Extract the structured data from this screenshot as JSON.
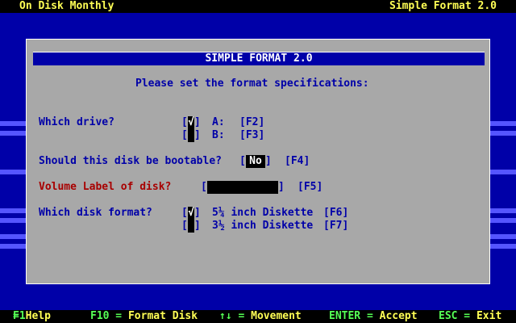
{
  "header": {
    "left": "On Disk Monthly",
    "right": "Simple Format 2.0"
  },
  "dialog": {
    "title": "SIMPLE FORMAT 2.0",
    "prompt": "Please set the format specifications:",
    "drive": {
      "label": "Which drive?",
      "options": [
        {
          "name": "A:",
          "key": "[F2]",
          "checked": true
        },
        {
          "name": "B:",
          "key": "[F3]",
          "checked": false
        }
      ]
    },
    "bootable": {
      "label": "Should this disk be bootable?",
      "value": "No",
      "key": "[F4]"
    },
    "volume": {
      "label": "Volume Label of disk?",
      "value": "",
      "key": "[F5]"
    },
    "disk_format": {
      "label": "Which disk format?",
      "options": [
        {
          "name": "5¼ inch Diskette",
          "key": "[F6]",
          "checked": true
        },
        {
          "name": "3½ inch Diskette",
          "key": "[F7]",
          "checked": false
        }
      ]
    },
    "check_glyph": "√"
  },
  "footer": [
    {
      "key": "F1",
      "desc": "Help"
    },
    {
      "key": "F10",
      "desc": "Format Disk"
    },
    {
      "key": "↑↓",
      "desc": "Movement"
    },
    {
      "key": "ENTER",
      "desc": "Accept"
    },
    {
      "key": "ESC",
      "desc": "Exit"
    }
  ],
  "colors": {
    "background": "#0000a8",
    "dialog": "#a8a8a8",
    "dialog_text": "#0000a8",
    "highlight_label": "#a80000",
    "stripe": "#5555ff",
    "footer_key": "#55ff55",
    "footer_desc": "#ffff55"
  }
}
